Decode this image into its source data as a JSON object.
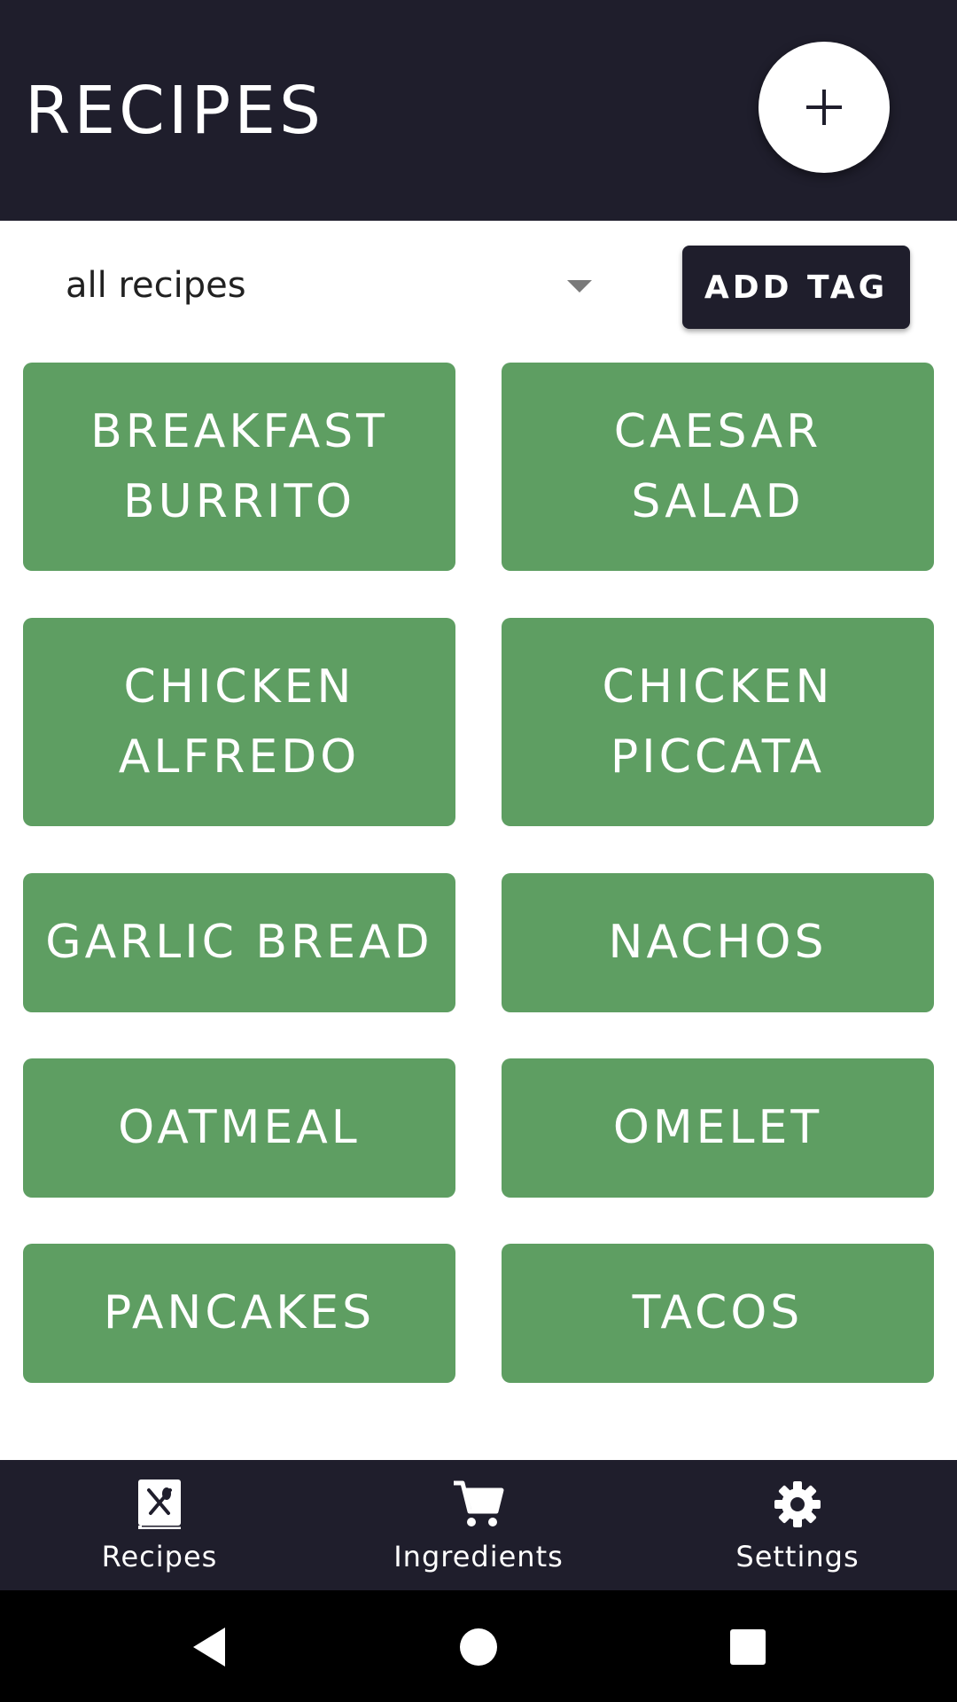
{
  "header": {
    "title": "RECIPES",
    "add_icon": "plus-icon"
  },
  "filter": {
    "selected": "all recipes",
    "add_tag_label": "ADD TAG"
  },
  "recipes": [
    "BREAKFAST BURRITO",
    "CAESAR SALAD",
    "CHICKEN ALFREDO",
    "CHICKEN PICCATA",
    "GARLIC BREAD",
    "NACHOS",
    "OATMEAL",
    "OMELET",
    "PANCAKES",
    "TACOS"
  ],
  "bottom_nav": {
    "items": [
      {
        "label": "Recipes",
        "icon": "recipe-book-icon"
      },
      {
        "label": "Ingredients",
        "icon": "shopping-cart-icon"
      },
      {
        "label": "Settings",
        "icon": "gear-icon"
      }
    ]
  },
  "system_nav": {
    "back_icon": "back-triangle-icon",
    "home_icon": "home-circle-icon",
    "recents_icon": "recents-square-icon"
  },
  "colors": {
    "header_bg": "#1f1e2c",
    "card_green": "#5e9e62",
    "text_light": "#ffffff"
  }
}
